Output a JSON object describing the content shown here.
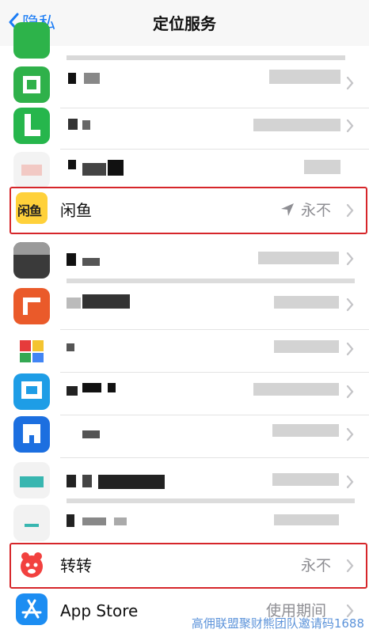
{
  "navbar": {
    "back_label": "隐私",
    "title": "定位服务"
  },
  "rows": [
    {
      "label": "闲鱼",
      "icon_text": "闲鱼",
      "value": "永不",
      "value_icon": "location-arrow-icon"
    },
    {
      "label": "转转",
      "value": "永不"
    },
    {
      "label": "App Store",
      "value": "使用期间"
    }
  ],
  "colors": {
    "accent": "#1a7cf5",
    "highlight": "#d6262a",
    "xianyu": "#ffd13a",
    "zhuanzhuan": "#f2413f",
    "appstore": "#1c8df2"
  },
  "watermark": "高佣联盟聚财熊团队邀请码1688"
}
